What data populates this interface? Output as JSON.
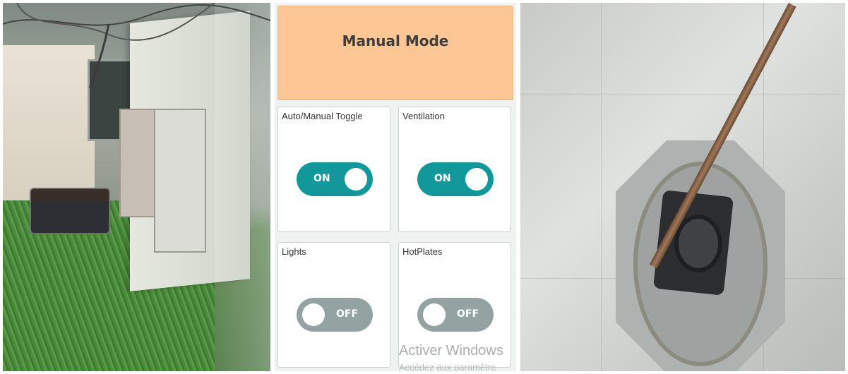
{
  "app": {
    "banner_title": "Manual Mode",
    "cards": [
      {
        "label": "Auto/Manual Toggle",
        "state": "ON"
      },
      {
        "label": "Ventilation",
        "state": "ON"
      },
      {
        "label": "Lights",
        "state": "OFF"
      },
      {
        "label": "HotPlates",
        "state": "OFF"
      }
    ],
    "watermark": {
      "line1": "Activer Windows",
      "line2": "Accédez aux paramètre"
    }
  },
  "colors": {
    "banner_bg": "#fdc795",
    "toggle_on": "#12989a",
    "toggle_off": "#94a3a2"
  }
}
